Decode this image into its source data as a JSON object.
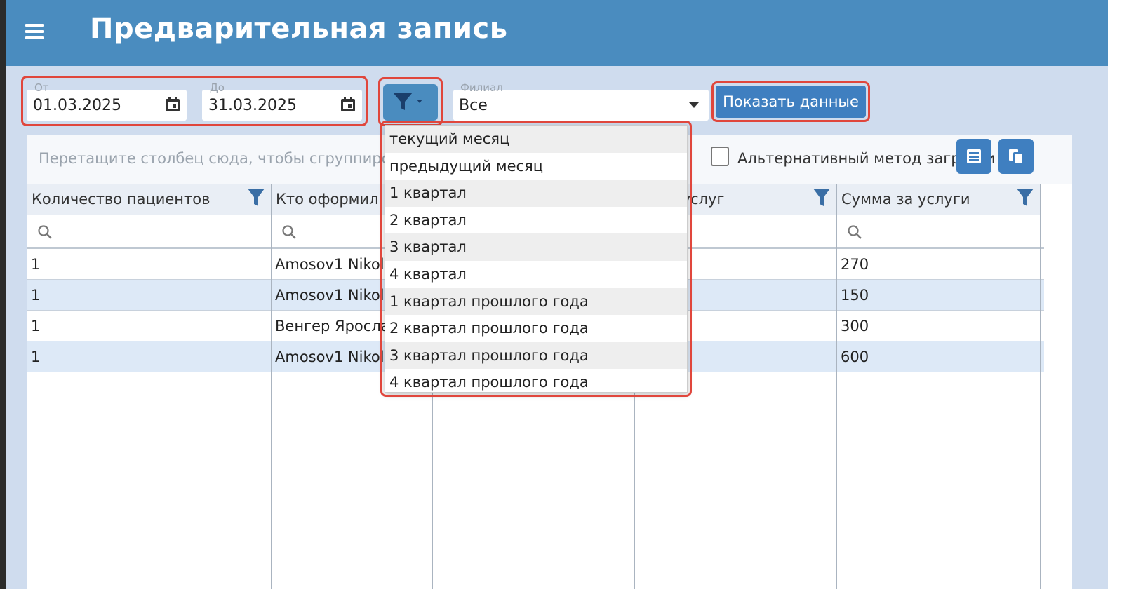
{
  "header": {
    "title": "Предварительная запись",
    "menu_icon": "hamburger-menu-icon"
  },
  "filters": {
    "from": {
      "label": "От",
      "value": "01.03.2025"
    },
    "to": {
      "label": "До",
      "value": "31.03.2025"
    },
    "branch": {
      "label": "Филиал",
      "value": "Все"
    },
    "show_button": "Показать данные"
  },
  "period_menu": {
    "items": [
      "текущий месяц",
      "предыдущий месяц",
      "1 квартал",
      "2 квартал",
      "3 квартал",
      "4 квартал",
      "1 квартал прошлого года",
      "2 квартал прошлого года",
      "3 квартал прошлого года",
      "4 квартал прошлого года"
    ]
  },
  "grid": {
    "group_hint": "Перетащите столбец сюда, чтобы сгруппировать",
    "alt_load_label": "Альтернативный метод загрузки",
    "columns": [
      "Количество пациентов",
      "Кто оформил",
      "",
      "Количество услуг",
      "Сумма за услуги"
    ],
    "rows": [
      [
        "1",
        "Amosov1 Nikolay",
        "",
        "",
        "270"
      ],
      [
        "1",
        "Amosov1 Nikolay",
        "",
        "",
        "150"
      ],
      [
        "1",
        "Венгер Ярослав",
        "",
        "",
        "300"
      ],
      [
        "1",
        "Amosov1 Nikolay",
        "",
        "",
        "600"
      ]
    ]
  },
  "colors": {
    "header": "#4a8cbf",
    "accent": "#3f7fc0",
    "highlight": "#e0463c",
    "row_alt": "#dde9f7"
  }
}
